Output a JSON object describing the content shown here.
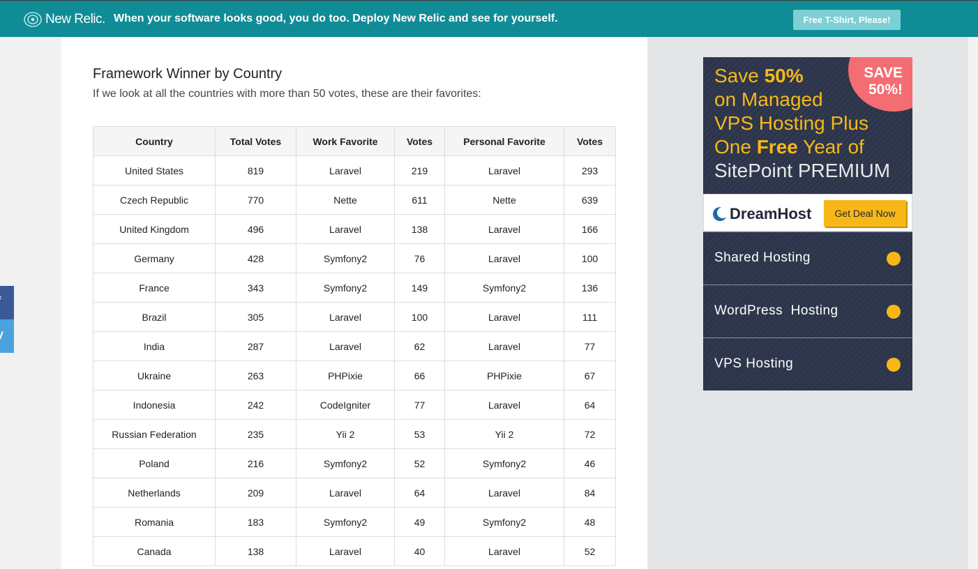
{
  "banner": {
    "logo_text": "New Relic.",
    "tagline": "When your software looks good, you do too. Deploy New Relic and see for yourself.",
    "cta": "Free T-Shirt, Please!",
    "background": "#0f8c96"
  },
  "article": {
    "title": "Framework Winner by Country",
    "subtitle": "If we look at all the countries with more than 50 votes, these are their favorites:",
    "table": {
      "headers": [
        "Country",
        "Total Votes",
        "Work Favorite",
        "Votes",
        "Personal Favorite",
        "Votes"
      ],
      "rows": [
        [
          "United States",
          "819",
          "Laravel",
          "219",
          "Laravel",
          "293"
        ],
        [
          "Czech Republic",
          "770",
          "Nette",
          "611",
          "Nette",
          "639"
        ],
        [
          "United Kingdom",
          "496",
          "Laravel",
          "138",
          "Laravel",
          "166"
        ],
        [
          "Germany",
          "428",
          "Symfony2",
          "76",
          "Laravel",
          "100"
        ],
        [
          "France",
          "343",
          "Symfony2",
          "149",
          "Symfony2",
          "136"
        ],
        [
          "Brazil",
          "305",
          "Laravel",
          "100",
          "Laravel",
          "111"
        ],
        [
          "India",
          "287",
          "Laravel",
          "62",
          "Laravel",
          "77"
        ],
        [
          "Ukraine",
          "263",
          "PHPixie",
          "66",
          "PHPixie",
          "67"
        ],
        [
          "Indonesia",
          "242",
          "CodeIgniter",
          "77",
          "Laravel",
          "64"
        ],
        [
          "Russian Federation",
          "235",
          "Yii 2",
          "53",
          "Yii 2",
          "72"
        ],
        [
          "Poland",
          "216",
          "Symfony2",
          "52",
          "Symfony2",
          "46"
        ],
        [
          "Netherlands",
          "209",
          "Laravel",
          "64",
          "Laravel",
          "84"
        ],
        [
          "Romania",
          "183",
          "Symfony2",
          "49",
          "Symfony2",
          "48"
        ],
        [
          "Canada",
          "138",
          "Laravel",
          "40",
          "Laravel",
          "52"
        ]
      ]
    }
  },
  "share": {
    "facebook_icon": "facebook-icon",
    "twitter_icon": "twitter-icon"
  },
  "ad": {
    "save_line1": "SAVE",
    "save_line2": "50%!",
    "h_save": "Save ",
    "h_50": "50%",
    "h_line2": "on Managed",
    "h_line3": "VPS Hosting Plus",
    "h_one": "One ",
    "h_free": "Free",
    "h_year": " Year of",
    "h_line5": "SitePoint PREMIUM",
    "dh_logo": "DreamHost",
    "dh_button": "Get Deal Now",
    "items": [
      "Shared Hosting",
      "WordPress  Hosting",
      "VPS Hosting"
    ],
    "accent": "#f7b817"
  }
}
